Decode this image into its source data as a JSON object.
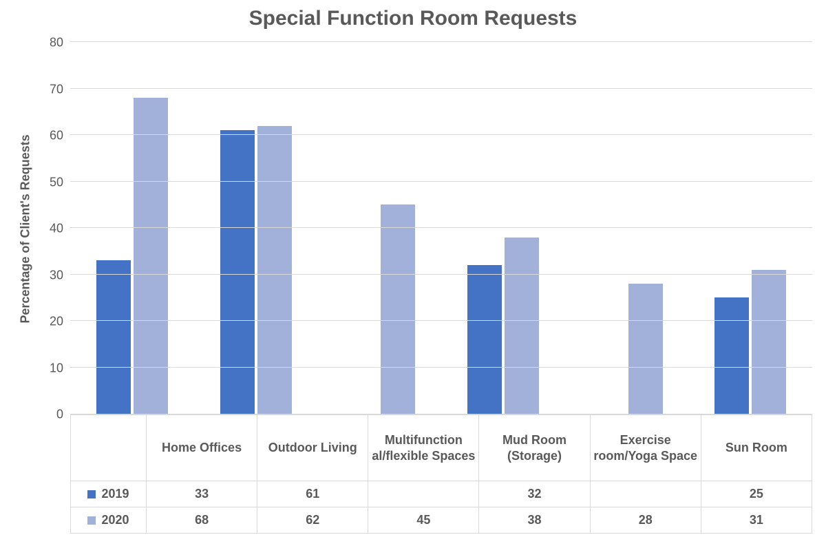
{
  "chart_data": {
    "type": "bar",
    "title": "Special Function Room Requests",
    "ylabel": "Percentage of Client's Requests",
    "xlabel": "",
    "ylim": [
      0,
      80
    ],
    "yticks": [
      0,
      10,
      20,
      30,
      40,
      50,
      60,
      70,
      80
    ],
    "categories": [
      "Home Offices",
      "Outdoor Living",
      "Multifunctional/flexible Spaces",
      "Mud Room (Storage)",
      "Exercise room/Yoga Space",
      "Sun Room"
    ],
    "series": [
      {
        "name": "2019",
        "color": "#4472c4",
        "values": [
          33,
          61,
          null,
          32,
          null,
          25
        ]
      },
      {
        "name": "2020",
        "color": "#a2b1da",
        "values": [
          68,
          62,
          45,
          38,
          28,
          31
        ]
      }
    ],
    "category_display": [
      "Home Offices",
      "Outdoor Living",
      "Multifunction al/flexible Spaces",
      "Mud Room (Storage)",
      "Exercise room/Yoga Space",
      "Sun Room"
    ]
  }
}
